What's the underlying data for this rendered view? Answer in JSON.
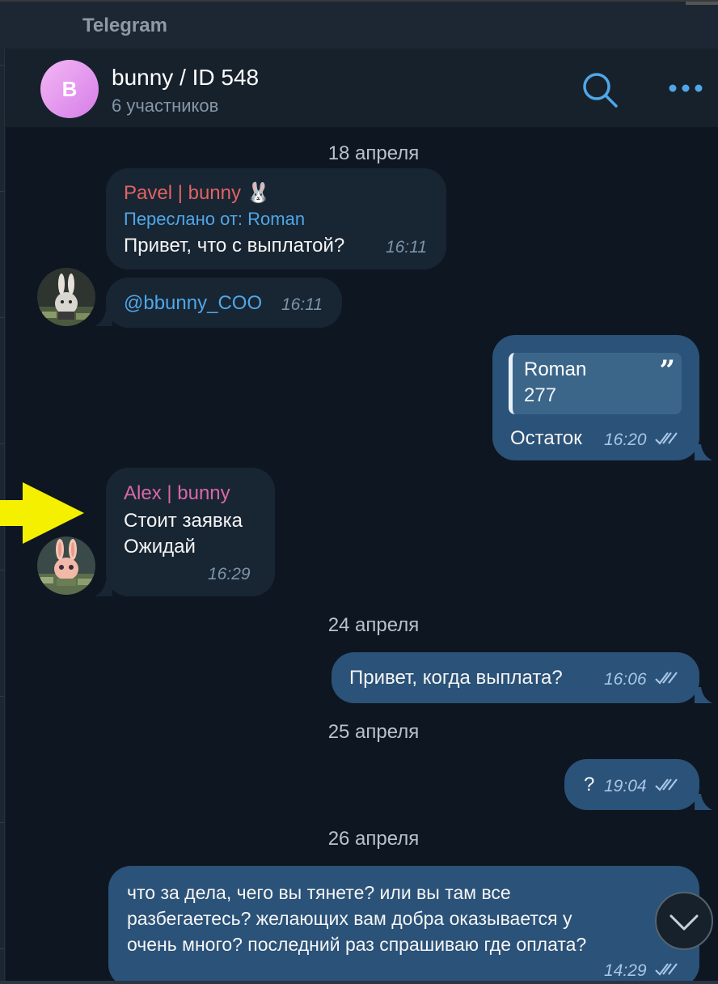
{
  "app": {
    "title": "Telegram"
  },
  "header": {
    "avatar_letter": "B",
    "chat_name": "bunny / ID 548",
    "subtitle": "6 участников",
    "search_icon": "search-icon",
    "more_icon": "more-dots-icon",
    "accent_color": "#4fa7e8"
  },
  "dates": {
    "d1": "18 апреля",
    "d2": "24 апреля",
    "d3": "25 апреля",
    "d4": "26 апреля"
  },
  "messages": {
    "m1": {
      "sender": "Pavel | bunny 🐰",
      "forwarded": "Переслано от: Roman",
      "text": "Привет, что с выплатой?",
      "time": "16:11"
    },
    "m2": {
      "text": "@bbunny_COO",
      "time": "16:11"
    },
    "m3": {
      "quote_name": "Roman",
      "quote_text": "277",
      "text": "Остаток",
      "time": "16:20"
    },
    "m4": {
      "sender": "Alex | bunny",
      "line1": "Стоит заявка",
      "line2": "Ожидай",
      "time": "16:29"
    },
    "m5": {
      "text": "Привет, когда выплата?",
      "time": "16:06"
    },
    "m6": {
      "text": "?",
      "time": "19:04"
    },
    "m7": {
      "line1": "что за дела, чего вы тянете? или вы там все",
      "line2": "разбегаетесь? желающих вам добра оказывается у",
      "line3": "очень много? последний раз спрашиваю где оплата?",
      "time": "14:29"
    }
  },
  "colors": {
    "incoming_bubble": "#182533",
    "outgoing_bubble": "#2b5278",
    "background": "#0e1621",
    "annotation_arrow": "#f5f000"
  }
}
